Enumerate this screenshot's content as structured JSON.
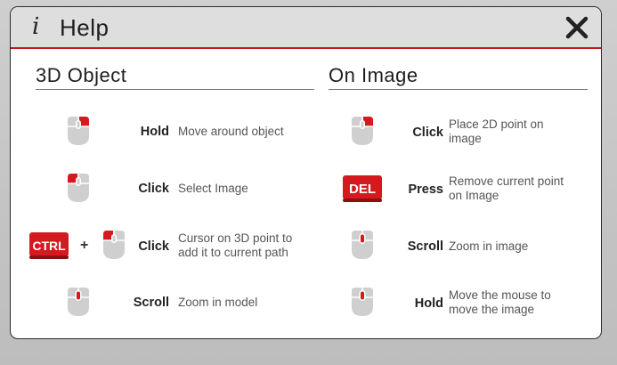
{
  "dialog": {
    "title": "Help",
    "info_icon": "i",
    "close_icon": "close-x-icon"
  },
  "sections": {
    "object": {
      "title": "3D Object",
      "rows": [
        {
          "icon": "mouse-right-click-icon",
          "verb": "Hold",
          "desc1": "Move around object",
          "desc2": ""
        },
        {
          "icon": "mouse-left-click-icon",
          "verb": "Click",
          "desc1": "Select Image",
          "desc2": ""
        },
        {
          "icon": "ctrl-key-icon",
          "plus": "+",
          "icon2": "mouse-left-click-icon",
          "verb": "Click",
          "desc1": "Cursor on 3D point to",
          "desc2": "add it to current path"
        },
        {
          "icon": "mouse-scroll-icon",
          "verb": "Scroll",
          "desc1": "Zoom in model",
          "desc2": ""
        }
      ]
    },
    "image": {
      "title": "On Image",
      "rows": [
        {
          "icon": "mouse-right-click-icon",
          "verb": "Click",
          "desc1": "Place 2D point on",
          "desc2": "image"
        },
        {
          "icon": "del-key-icon",
          "verb": "Press",
          "desc1": "Remove current point",
          "desc2": "on Image"
        },
        {
          "icon": "mouse-scroll-icon",
          "verb": "Scroll",
          "desc1": "Zoom in image",
          "desc2": ""
        },
        {
          "icon": "mouse-scroll-icon",
          "verb": "Hold",
          "desc1": "Move the mouse to",
          "desc2": "move the image"
        }
      ]
    }
  },
  "keys": {
    "ctrl_label": "CTRL",
    "del_label": "DEL"
  },
  "colors": {
    "accent_red": "#c4161c",
    "title_bar": "#dedede",
    "mouse_body": "#cfcfcf"
  }
}
